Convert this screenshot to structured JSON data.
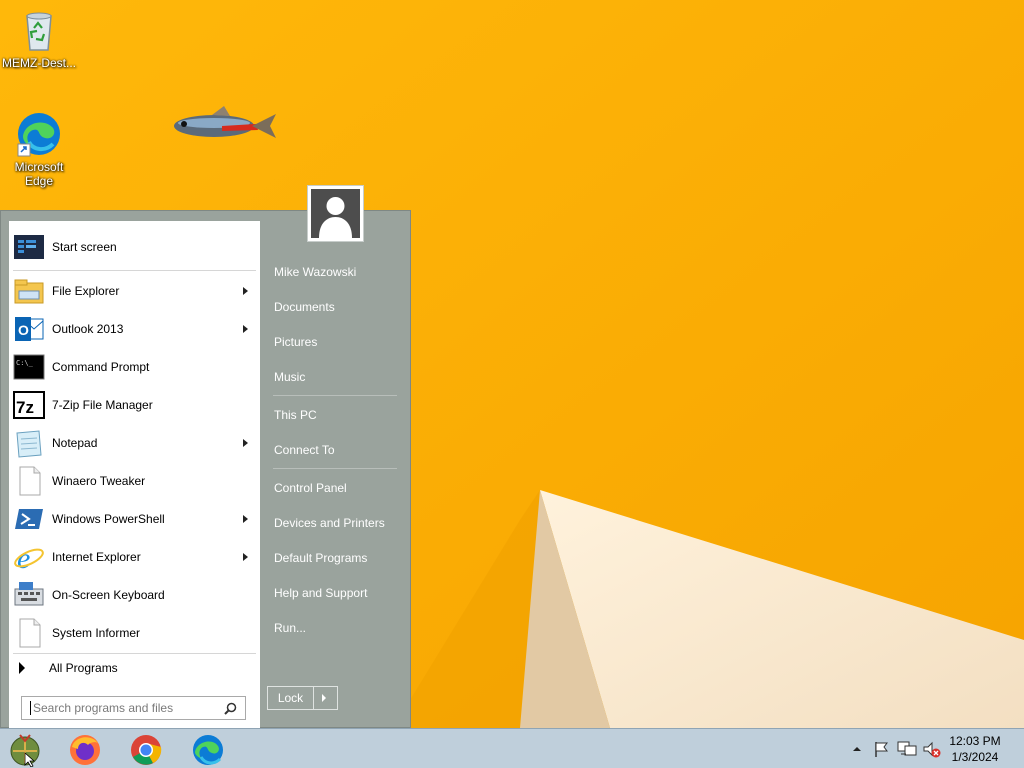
{
  "desktop": {
    "icons": [
      {
        "label": "MEMZ-Dest...",
        "icon": "recycle-bin-icon"
      },
      {
        "label": "Microsoft Edge",
        "icon": "edge-icon"
      }
    ]
  },
  "start_menu": {
    "pinned": [
      {
        "label": "Start screen",
        "icon": "start-screen-icon",
        "submenu": false
      },
      {
        "label": "File Explorer",
        "icon": "file-explorer-icon",
        "submenu": true
      },
      {
        "label": "Outlook 2013",
        "icon": "outlook-icon",
        "submenu": true
      },
      {
        "label": "Command Prompt",
        "icon": "command-prompt-icon",
        "submenu": false
      },
      {
        "label": "7-Zip File Manager",
        "icon": "7zip-icon",
        "submenu": false
      },
      {
        "label": "Notepad",
        "icon": "notepad-icon",
        "submenu": true
      },
      {
        "label": "Winaero Tweaker",
        "icon": "blank-document-icon",
        "submenu": false
      },
      {
        "label": "Windows PowerShell",
        "icon": "powershell-icon",
        "submenu": true
      },
      {
        "label": "Internet Explorer",
        "icon": "internet-explorer-icon",
        "submenu": true
      },
      {
        "label": "On-Screen Keyboard",
        "icon": "keyboard-icon",
        "submenu": false
      },
      {
        "label": "System Informer",
        "icon": "blank-document-icon",
        "submenu": false
      }
    ],
    "all_programs": "All Programs",
    "search_placeholder": "Search programs and files",
    "right_links": {
      "user": "Mike Wazowski",
      "documents": "Documents",
      "pictures": "Pictures",
      "music": "Music",
      "this_pc": "This PC",
      "connect_to": "Connect To",
      "control_panel": "Control Panel",
      "devices_printers": "Devices and Printers",
      "default_programs": "Default Programs",
      "help_support": "Help and Support",
      "run": "Run..."
    },
    "lock_label": "Lock"
  },
  "taskbar": {
    "items": [
      "start-orb-icon",
      "firefox-icon",
      "chrome-icon",
      "edge-icon"
    ],
    "tray": [
      "show-hidden-icons-arrow",
      "action-center-flag-icon",
      "network-icon",
      "volume-muted-icon"
    ],
    "time": "12:03 PM",
    "date": "1/3/2024"
  },
  "colors": {
    "wallpaper": "#ffb300",
    "start_menu_right": "#9aa39d",
    "taskbar": "#bfcfdb"
  }
}
